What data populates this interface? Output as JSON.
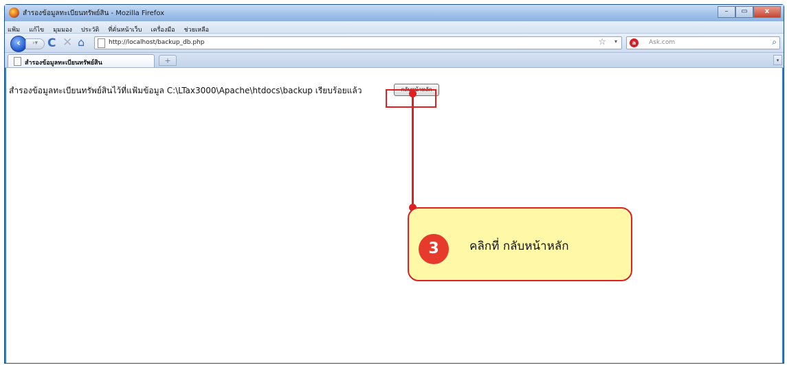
{
  "window": {
    "title": "สำรองข้อมูลทะเบียนทรัพย์สิน - Mozilla Firefox",
    "controls": {
      "minimize": "–",
      "maximize": "▭",
      "close": "x"
    }
  },
  "menu": [
    "แฟ้ม",
    "แก้ไข",
    "มุมมอง",
    "ประวัติ",
    "ที่คั่นหน้าเว็บ",
    "เครื่องมือ",
    "ช่วยเหลือ"
  ],
  "address": {
    "url": "http://localhost/backup_db.php"
  },
  "search": {
    "placeholder": "Ask.com"
  },
  "tab": {
    "label": "สำรองข้อมูลทะเบียนทรัพย์สิน",
    "new_tab": "+"
  },
  "page": {
    "message": "สำรองข้อมูลทะเบียนทรัพย์สินไว้ที่แฟ้มข้อมูล C:\\LTax3000\\Apache\\htdocs\\backup เรียบร้อยแล้ว",
    "button_label": "กลับหน้าหลัก"
  },
  "annotation": {
    "step": "3",
    "text": "คลิกที่   กลับหน้าหลัก"
  },
  "colors": {
    "highlight": "#e02020",
    "callout_fill": "#fff8a6",
    "frame": "#2f7fd2"
  }
}
